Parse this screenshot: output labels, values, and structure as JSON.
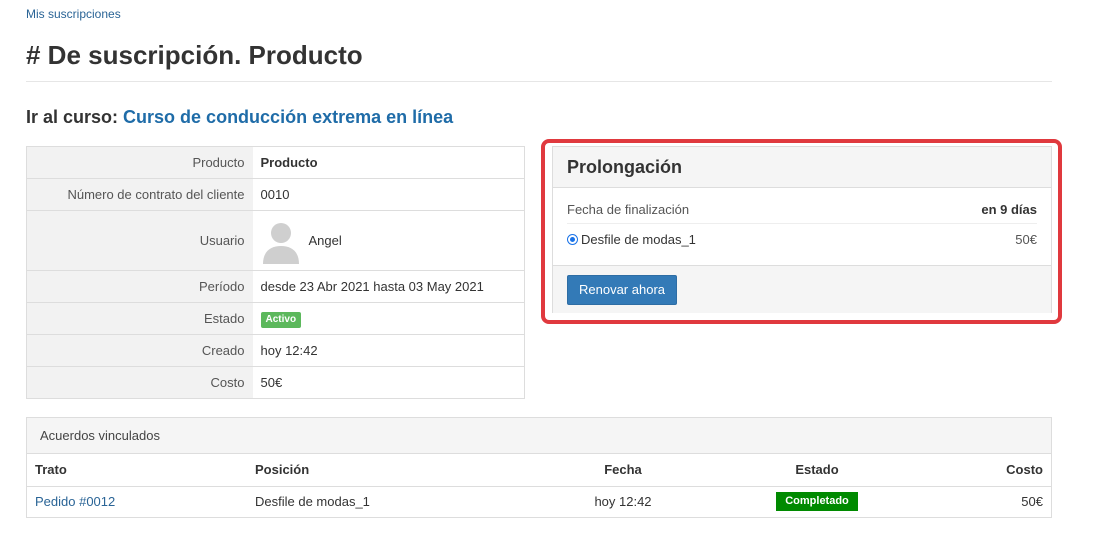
{
  "breadcrumb": "Mis suscripciones",
  "title": "# De suscripción. Producto",
  "course": {
    "prefix": "Ir al curso:",
    "link": "Curso de conducción extrema en línea"
  },
  "details": [
    {
      "label": "Producto",
      "value": "Producto"
    },
    {
      "label": "Número de contrato del cliente",
      "value": "0010"
    },
    {
      "label": "Usuario",
      "value": "Angel"
    },
    {
      "label": "Período",
      "value": "desde 23 Abr 2021 hasta 03 May 2021"
    },
    {
      "label": "Estado",
      "value": "Activo"
    },
    {
      "label": "Creado",
      "value": "hoy 12:42"
    },
    {
      "label": "Costo",
      "value": "50€"
    }
  ],
  "prolongation": {
    "title": "Prolongación",
    "end_label": "Fecha de finalización",
    "end_value": "en 9 días",
    "option_label": "Desfile de modas_1",
    "option_price": "50€",
    "renew_button": "Renovar ahora"
  },
  "agreements": {
    "title": "Acuerdos vinculados",
    "columns": [
      "Trato",
      "Posición",
      "Fecha",
      "Estado",
      "Costo"
    ],
    "rows": [
      {
        "trato": "Pedido #0012",
        "posicion": "Desfile de modas_1",
        "fecha": "hoy 12:42",
        "estado": "Completado",
        "costo": "50€"
      }
    ]
  },
  "colors": {
    "accent": "#337ab7",
    "link": "#2a6496",
    "active_badge": "#5cb85c",
    "completed_badge": "#008a00",
    "highlight": "#e0393e"
  }
}
